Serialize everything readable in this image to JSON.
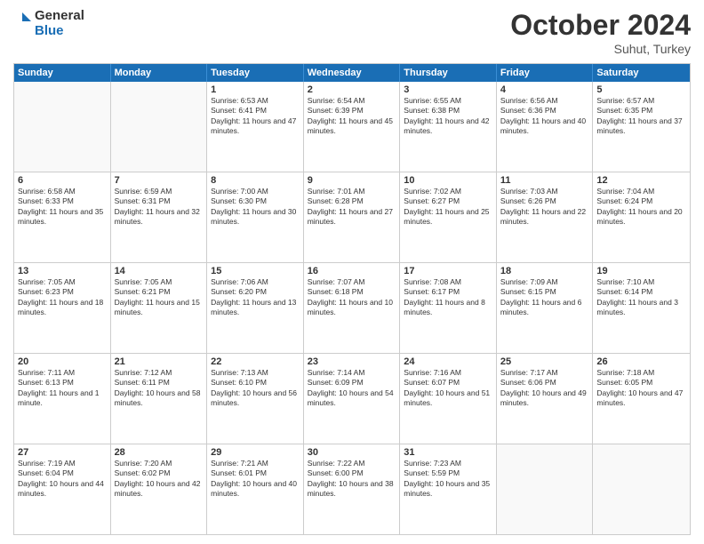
{
  "logo": {
    "line1": "General",
    "line2": "Blue"
  },
  "title": "October 2024",
  "location": "Suhut, Turkey",
  "header_days": [
    "Sunday",
    "Monday",
    "Tuesday",
    "Wednesday",
    "Thursday",
    "Friday",
    "Saturday"
  ],
  "weeks": [
    [
      {
        "day": "",
        "sunrise": "",
        "sunset": "",
        "daylight": "",
        "empty": true
      },
      {
        "day": "",
        "sunrise": "",
        "sunset": "",
        "daylight": "",
        "empty": true
      },
      {
        "day": "1",
        "sunrise": "Sunrise: 6:53 AM",
        "sunset": "Sunset: 6:41 PM",
        "daylight": "Daylight: 11 hours and 47 minutes."
      },
      {
        "day": "2",
        "sunrise": "Sunrise: 6:54 AM",
        "sunset": "Sunset: 6:39 PM",
        "daylight": "Daylight: 11 hours and 45 minutes."
      },
      {
        "day": "3",
        "sunrise": "Sunrise: 6:55 AM",
        "sunset": "Sunset: 6:38 PM",
        "daylight": "Daylight: 11 hours and 42 minutes."
      },
      {
        "day": "4",
        "sunrise": "Sunrise: 6:56 AM",
        "sunset": "Sunset: 6:36 PM",
        "daylight": "Daylight: 11 hours and 40 minutes."
      },
      {
        "day": "5",
        "sunrise": "Sunrise: 6:57 AM",
        "sunset": "Sunset: 6:35 PM",
        "daylight": "Daylight: 11 hours and 37 minutes."
      }
    ],
    [
      {
        "day": "6",
        "sunrise": "Sunrise: 6:58 AM",
        "sunset": "Sunset: 6:33 PM",
        "daylight": "Daylight: 11 hours and 35 minutes."
      },
      {
        "day": "7",
        "sunrise": "Sunrise: 6:59 AM",
        "sunset": "Sunset: 6:31 PM",
        "daylight": "Daylight: 11 hours and 32 minutes."
      },
      {
        "day": "8",
        "sunrise": "Sunrise: 7:00 AM",
        "sunset": "Sunset: 6:30 PM",
        "daylight": "Daylight: 11 hours and 30 minutes."
      },
      {
        "day": "9",
        "sunrise": "Sunrise: 7:01 AM",
        "sunset": "Sunset: 6:28 PM",
        "daylight": "Daylight: 11 hours and 27 minutes."
      },
      {
        "day": "10",
        "sunrise": "Sunrise: 7:02 AM",
        "sunset": "Sunset: 6:27 PM",
        "daylight": "Daylight: 11 hours and 25 minutes."
      },
      {
        "day": "11",
        "sunrise": "Sunrise: 7:03 AM",
        "sunset": "Sunset: 6:26 PM",
        "daylight": "Daylight: 11 hours and 22 minutes."
      },
      {
        "day": "12",
        "sunrise": "Sunrise: 7:04 AM",
        "sunset": "Sunset: 6:24 PM",
        "daylight": "Daylight: 11 hours and 20 minutes."
      }
    ],
    [
      {
        "day": "13",
        "sunrise": "Sunrise: 7:05 AM",
        "sunset": "Sunset: 6:23 PM",
        "daylight": "Daylight: 11 hours and 18 minutes."
      },
      {
        "day": "14",
        "sunrise": "Sunrise: 7:05 AM",
        "sunset": "Sunset: 6:21 PM",
        "daylight": "Daylight: 11 hours and 15 minutes."
      },
      {
        "day": "15",
        "sunrise": "Sunrise: 7:06 AM",
        "sunset": "Sunset: 6:20 PM",
        "daylight": "Daylight: 11 hours and 13 minutes."
      },
      {
        "day": "16",
        "sunrise": "Sunrise: 7:07 AM",
        "sunset": "Sunset: 6:18 PM",
        "daylight": "Daylight: 11 hours and 10 minutes."
      },
      {
        "day": "17",
        "sunrise": "Sunrise: 7:08 AM",
        "sunset": "Sunset: 6:17 PM",
        "daylight": "Daylight: 11 hours and 8 minutes."
      },
      {
        "day": "18",
        "sunrise": "Sunrise: 7:09 AM",
        "sunset": "Sunset: 6:15 PM",
        "daylight": "Daylight: 11 hours and 6 minutes."
      },
      {
        "day": "19",
        "sunrise": "Sunrise: 7:10 AM",
        "sunset": "Sunset: 6:14 PM",
        "daylight": "Daylight: 11 hours and 3 minutes."
      }
    ],
    [
      {
        "day": "20",
        "sunrise": "Sunrise: 7:11 AM",
        "sunset": "Sunset: 6:13 PM",
        "daylight": "Daylight: 11 hours and 1 minute."
      },
      {
        "day": "21",
        "sunrise": "Sunrise: 7:12 AM",
        "sunset": "Sunset: 6:11 PM",
        "daylight": "Daylight: 10 hours and 58 minutes."
      },
      {
        "day": "22",
        "sunrise": "Sunrise: 7:13 AM",
        "sunset": "Sunset: 6:10 PM",
        "daylight": "Daylight: 10 hours and 56 minutes."
      },
      {
        "day": "23",
        "sunrise": "Sunrise: 7:14 AM",
        "sunset": "Sunset: 6:09 PM",
        "daylight": "Daylight: 10 hours and 54 minutes."
      },
      {
        "day": "24",
        "sunrise": "Sunrise: 7:16 AM",
        "sunset": "Sunset: 6:07 PM",
        "daylight": "Daylight: 10 hours and 51 minutes."
      },
      {
        "day": "25",
        "sunrise": "Sunrise: 7:17 AM",
        "sunset": "Sunset: 6:06 PM",
        "daylight": "Daylight: 10 hours and 49 minutes."
      },
      {
        "day": "26",
        "sunrise": "Sunrise: 7:18 AM",
        "sunset": "Sunset: 6:05 PM",
        "daylight": "Daylight: 10 hours and 47 minutes."
      }
    ],
    [
      {
        "day": "27",
        "sunrise": "Sunrise: 7:19 AM",
        "sunset": "Sunset: 6:04 PM",
        "daylight": "Daylight: 10 hours and 44 minutes."
      },
      {
        "day": "28",
        "sunrise": "Sunrise: 7:20 AM",
        "sunset": "Sunset: 6:02 PM",
        "daylight": "Daylight: 10 hours and 42 minutes."
      },
      {
        "day": "29",
        "sunrise": "Sunrise: 7:21 AM",
        "sunset": "Sunset: 6:01 PM",
        "daylight": "Daylight: 10 hours and 40 minutes."
      },
      {
        "day": "30",
        "sunrise": "Sunrise: 7:22 AM",
        "sunset": "Sunset: 6:00 PM",
        "daylight": "Daylight: 10 hours and 38 minutes."
      },
      {
        "day": "31",
        "sunrise": "Sunrise: 7:23 AM",
        "sunset": "Sunset: 5:59 PM",
        "daylight": "Daylight: 10 hours and 35 minutes."
      },
      {
        "day": "",
        "sunrise": "",
        "sunset": "",
        "daylight": "",
        "empty": true
      },
      {
        "day": "",
        "sunrise": "",
        "sunset": "",
        "daylight": "",
        "empty": true
      }
    ]
  ]
}
